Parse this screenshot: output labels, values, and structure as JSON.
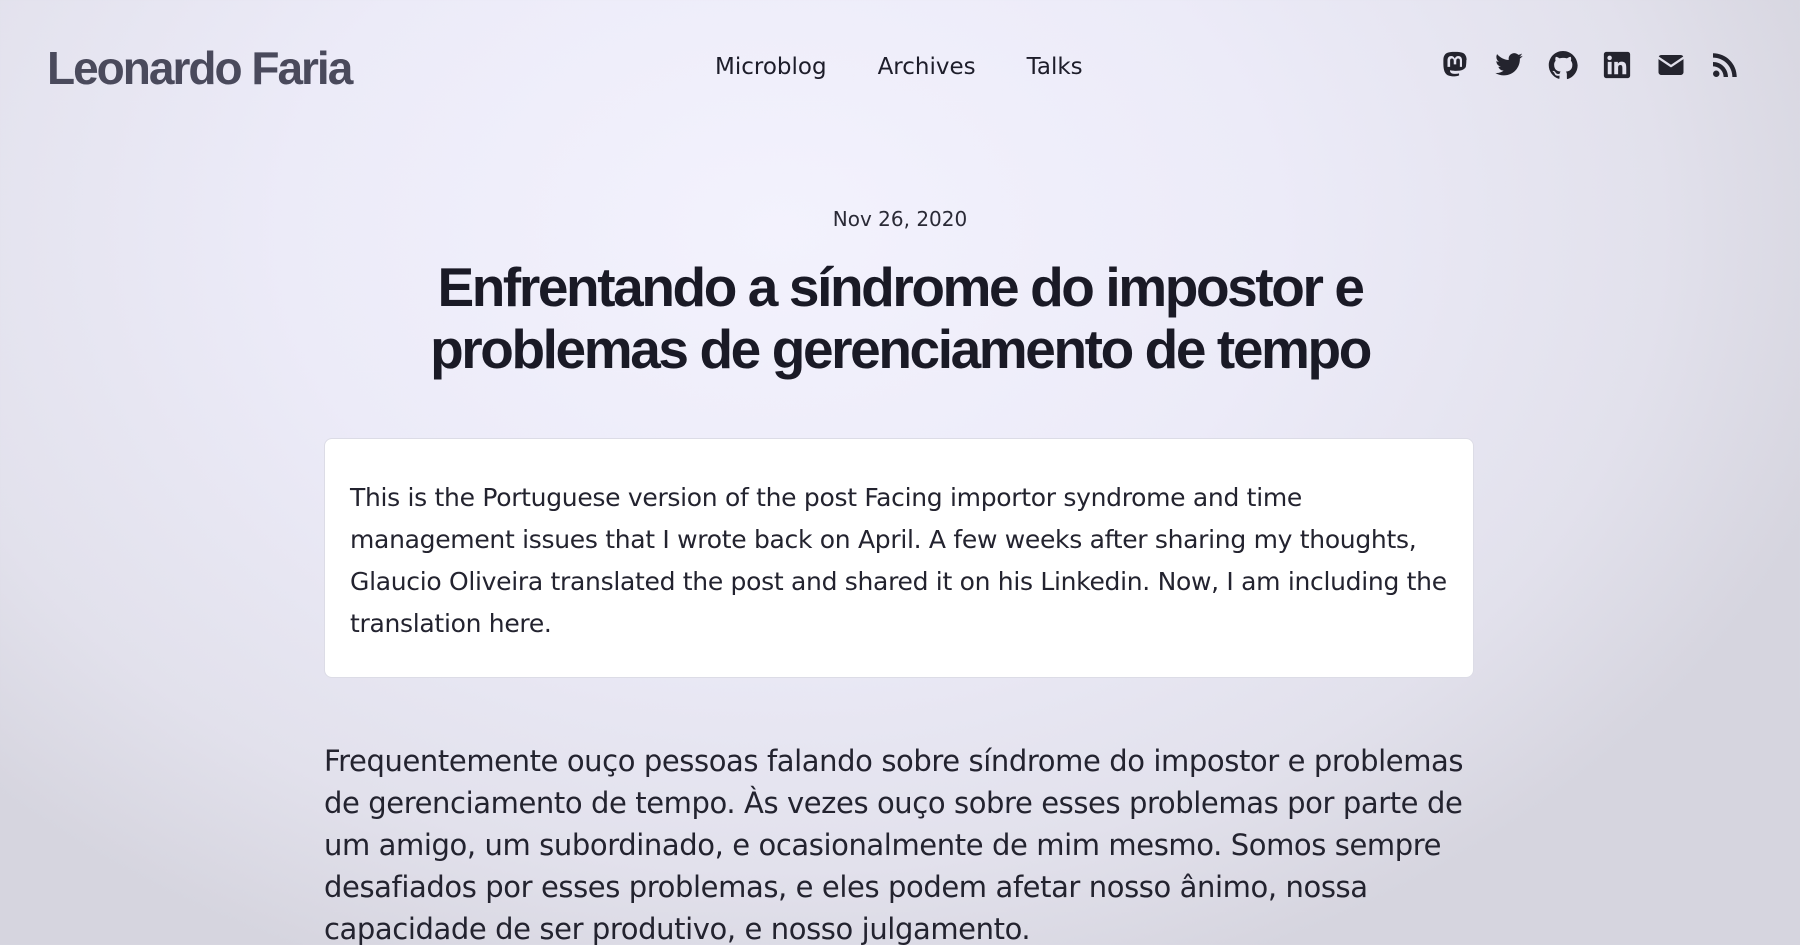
{
  "site": {
    "title": "Leonardo Faria"
  },
  "nav": {
    "items": [
      {
        "label": "Microblog"
      },
      {
        "label": "Archives"
      },
      {
        "label": "Talks"
      }
    ]
  },
  "social": {
    "icons": [
      "mastodon-icon",
      "twitter-icon",
      "github-icon",
      "linkedin-icon",
      "email-icon",
      "rss-icon"
    ]
  },
  "post": {
    "date": "Nov 26, 2020",
    "title": "Enfrentando a síndrome do impostor e problemas de gerenciamento de tempo",
    "note": "This is the Portuguese version of the post Facing importor syndrome and time management issues that I wrote back on April. A few weeks after sharing my thoughts, Glaucio Oliveira translated the post and shared it on his Linkedin. Now, I am including the translation here.",
    "paragraph": "Frequentemente ouço pessoas falando sobre síndrome do impostor e problemas de gerenciamento de tempo. Às vezes ouço sobre esses problemas por parte de um amigo, um subordinado, e ocasionalmente de mim mesmo. Somos sempre desafiados por esses problemas, e eles podem afetar nosso ânimo, nossa capacidade de ser produtivo, e nosso julgamento."
  },
  "colors": {
    "background": "#ecebf8",
    "text": "#1d1d2a",
    "site_title": "#4a4a5c",
    "card": "#ffffff"
  }
}
